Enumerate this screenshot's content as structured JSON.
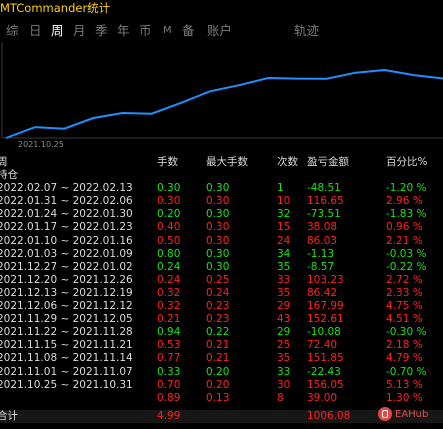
{
  "title": "MTCommander统计",
  "tabs": [
    {
      "label": "综"
    },
    {
      "label": "日"
    },
    {
      "label": "周",
      "active": true
    },
    {
      "label": "月"
    },
    {
      "label": "季"
    },
    {
      "label": "年"
    },
    {
      "label": "币"
    },
    {
      "label": "M"
    },
    {
      "label": "备"
    },
    {
      "label": "账户"
    },
    {
      "label": "轨迹"
    }
  ],
  "chart_data": {
    "type": "line",
    "x": [
      "2021.10.25",
      "2021.11.01",
      "2021.11.08",
      "2021.11.15",
      "2021.11.22",
      "2021.11.29",
      "2021.12.06",
      "2021.12.13",
      "2021.12.20",
      "2021.12.27",
      "2022.01.03",
      "2022.01.10",
      "2022.01.17",
      "2022.01.24",
      "2022.01.31",
      "2022.02.07"
    ],
    "values": [
      39.0,
      195.05,
      172.63,
      324.48,
      396.88,
      386.8,
      539.41,
      707.4,
      793.82,
      897.05,
      888.48,
      887.35,
      973.38,
      1011.46,
      937.95,
      889.44
    ],
    "x_tick_label": "2021.10.25",
    "line_color": "#1e90ff",
    "grid": false
  },
  "table": {
    "headers": {
      "period": "周",
      "lots": "手数",
      "maxlots": "最大手数",
      "count": "次数",
      "pnl": "盈亏金额",
      "pct": "百分比%"
    },
    "position_label": "持仓",
    "rows": [
      {
        "period": "2022.02.07 ~ 2022.02.13",
        "lots": "0.30",
        "maxlots": "0.30",
        "count": "1",
        "pnl": "-48.51",
        "pct": "-1.20 %",
        "color": "green"
      },
      {
        "period": "2022.01.31 ~ 2022.02.06",
        "lots": "0.30",
        "maxlots": "0.30",
        "count": "10",
        "pnl": "116.65",
        "pct": "2.96 %",
        "color": "red"
      },
      {
        "period": "2022.01.24 ~ 2022.01.30",
        "lots": "0.20",
        "maxlots": "0.30",
        "count": "32",
        "pnl": "-73.51",
        "pct": "-1.83 %",
        "color": "green"
      },
      {
        "period": "2022.01.17 ~ 2022.01.23",
        "lots": "0.40",
        "maxlots": "0.30",
        "count": "15",
        "pnl": "38.08",
        "pct": "0.96 %",
        "color": "red"
      },
      {
        "period": "2022.01.10 ~ 2022.01.16",
        "lots": "0.50",
        "maxlots": "0.30",
        "count": "24",
        "pnl": "86.03",
        "pct": "2.21 %",
        "color": "red"
      },
      {
        "period": "2022.01.03 ~ 2022.01.09",
        "lots": "0.80",
        "maxlots": "0.30",
        "count": "34",
        "pnl": "-1.13",
        "pct": "-0.03 %",
        "color": "green"
      },
      {
        "period": "2021.12.27 ~ 2022.01.02",
        "lots": "0.24",
        "maxlots": "0.30",
        "count": "35",
        "pnl": "-8.57",
        "pct": "-0.22 %",
        "color": "green"
      },
      {
        "period": "2021.12.20 ~ 2021.12.26",
        "lots": "0.24",
        "maxlots": "0.25",
        "count": "33",
        "pnl": "103.23",
        "pct": "2.72 %",
        "color": "red"
      },
      {
        "period": "2021.12.13 ~ 2021.12.19",
        "lots": "0.32",
        "maxlots": "0.24",
        "count": "35",
        "pnl": "86.42",
        "pct": "2.33 %",
        "color": "red"
      },
      {
        "period": "2021.12.06 ~ 2021.12.12",
        "lots": "0.32",
        "maxlots": "0.23",
        "count": "29",
        "pnl": "167.99",
        "pct": "4.75 %",
        "color": "red"
      },
      {
        "period": "2021.11.29 ~ 2021.12.05",
        "lots": "0.21",
        "maxlots": "0.23",
        "count": "43",
        "pnl": "152.61",
        "pct": "4.51 %",
        "color": "red"
      },
      {
        "period": "2021.11.22 ~ 2021.11.28",
        "lots": "0.94",
        "maxlots": "0.22",
        "count": "29",
        "pnl": "-10.08",
        "pct": "-0.30 %",
        "color": "green"
      },
      {
        "period": "2021.11.15 ~ 2021.11.21",
        "lots": "0.53",
        "maxlots": "0.21",
        "count": "25",
        "pnl": "72.40",
        "pct": "2.18 %",
        "color": "red"
      },
      {
        "period": "2021.11.08 ~ 2021.11.14",
        "lots": "0.77",
        "maxlots": "0.21",
        "count": "35",
        "pnl": "151.85",
        "pct": "4.79 %",
        "color": "red"
      },
      {
        "period": "2021.11.01 ~ 2021.11.07",
        "lots": "0.33",
        "maxlots": "0.20",
        "count": "33",
        "pnl": "-22.43",
        "pct": "-0.70 %",
        "color": "green"
      },
      {
        "period": "2021.10.25 ~ 2021.10.31",
        "lots": "0.70",
        "maxlots": "0.20",
        "count": "30",
        "pnl": "156.05",
        "pct": "5.13 %",
        "color": "red"
      },
      {
        "period": "",
        "lots": "0.89",
        "maxlots": "0.13",
        "count": "8",
        "pnl": "39.00",
        "pct": "1.30 %",
        "color": "red"
      }
    ],
    "total": {
      "label": "合计",
      "lots": "4.99",
      "pnl": "1006.08"
    }
  },
  "watermark": {
    "text": "EAHub"
  },
  "colors": {
    "profit": "#ff2020",
    "loss": "#18e418",
    "title": "#ffd200",
    "line": "#1e90ff",
    "background": "#000000"
  }
}
